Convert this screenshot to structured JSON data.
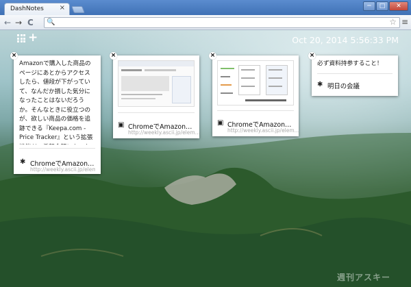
{
  "browser": {
    "tab_title": "DashNotes",
    "tab_close": "×",
    "window_buttons": [
      "─",
      "□",
      "✕"
    ],
    "nav": {
      "back": "←",
      "forward": "→",
      "reload": "C"
    },
    "omnibox_icon": "🔍",
    "star": "☆",
    "menu": "≡"
  },
  "dashboard": {
    "plus": "+",
    "clock": "Oct 20, 2014 5:56:33 PM"
  },
  "notes": [
    {
      "close": "×",
      "text": "Amazonで購入した商品のページにあとからアクセスしたら、値段が下がっていて、なんだか損した気分になったことはないだろうか。そんなときに役立つのが、欲しい商品の価格を追跡できる『Keepa.com - Price Tracker』という拡張機能だ。希望金額になったらメールなどで通知できるほか、価格の変遷がひと目でわかるグラフを節約できる。",
      "link_icon": "✱",
      "link_title": "ChromeでAmazon…",
      "link_url": "http://weekly.ascii.jp/elem…"
    },
    {
      "close": "×",
      "link_icon": "▣",
      "link_title": "ChromeでAmazon…",
      "link_url": "http://weekly.ascii.jp/elem…"
    },
    {
      "close": "×",
      "link_icon": "▣",
      "link_title": "ChromeでAmazon…",
      "link_url": "http://weekly.ascii.jp/elem…"
    },
    {
      "close": "×",
      "text": "必ず資料持参すること！",
      "item_icon": "✱",
      "item_text": "明日の会議"
    }
  ],
  "watermark": "週刊アスキー"
}
